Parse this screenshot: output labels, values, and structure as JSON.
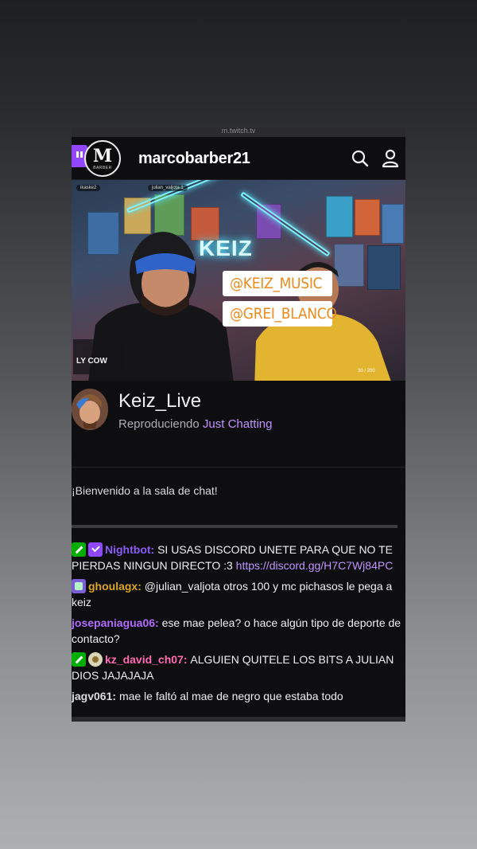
{
  "browser": {
    "url": "m.twitch.tv"
  },
  "header": {
    "channel_title": "marcobarber21",
    "logo_letter": "M",
    "logo_subtext": "BARBER",
    "icons": [
      "twitch-logo-icon",
      "search-icon",
      "user-icon"
    ]
  },
  "video": {
    "sign_text": "KEIZ",
    "overlay_label": "LY COW",
    "viewer_chip_1": "ikaske2",
    "viewer_chip_2": "julian_valjota 1",
    "counter": "30 / 200"
  },
  "stream": {
    "streamer_name": "Keiz_Live",
    "playing_prefix": "Reproduciendo",
    "category": "Just Chatting"
  },
  "tags": [
    "@KEIZ_MUSIC",
    "@GREI_BLANCO"
  ],
  "chat": {
    "welcome": "¡Bienvenido a la sala de chat!",
    "messages": [
      {
        "user": "Nightbot",
        "user_color": "#8a5cf5",
        "badges": [
          "mod",
          "verified"
        ],
        "text": "SI USAS DISCORD UNETE PARA QUE NO TE PIERDAS NINGUN DIRECTO :3",
        "link": "https://discord.gg/H7C7Wj84PC"
      },
      {
        "user": "ghoulagx",
        "user_color": "#daa520",
        "badges": [
          "sub"
        ],
        "text": "@julian_valjota otros 100 y mc pichasos le pega a keiz"
      },
      {
        "user": "josepaniagua06",
        "user_color": "#b36bff",
        "badges": [],
        "text": "ese mae pelea? o hace algún tipo de deporte de contacto?"
      },
      {
        "user": "kz_david_ch07",
        "user_color": "#ff69b4",
        "badges": [
          "mod",
          "gift"
        ],
        "text": "ALGUIEN QUITELE LOS BITS A JULIAN DIOS JAJAJAJA"
      },
      {
        "user": "jagv061",
        "user_color": "#dcdce0",
        "badges": [],
        "text": "mae le faltó al mae de negro que estaba todo"
      }
    ]
  },
  "colors": {
    "twitch_purple": "#9147ff",
    "background": "#0e0e10",
    "tag_orange": "#f08a1c"
  }
}
